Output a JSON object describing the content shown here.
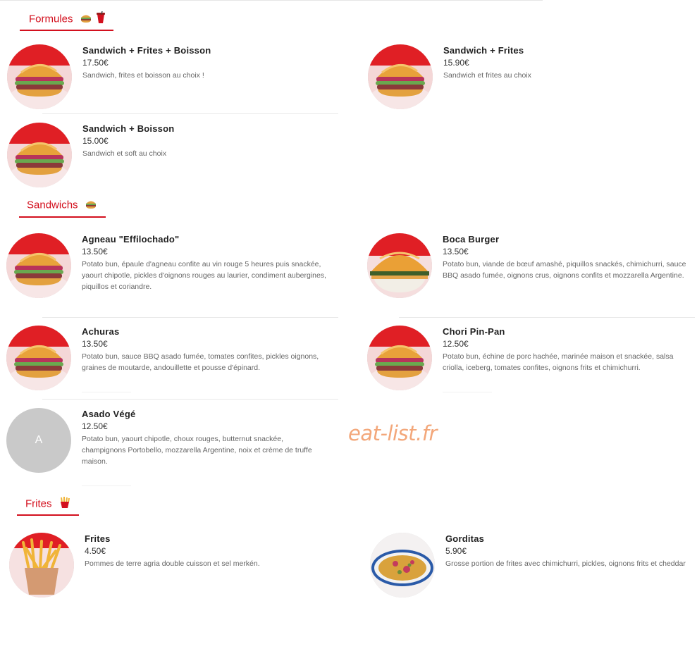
{
  "sections": {
    "formules": {
      "title": "Formules",
      "icons": [
        "burger-emoji",
        "cup-emoji"
      ]
    },
    "sandwichs": {
      "title": "Sandwichs",
      "icons": [
        "burger-emoji"
      ]
    },
    "frites": {
      "title": "Frites",
      "icons": [
        "fries-emoji"
      ]
    }
  },
  "items": {
    "sfb": {
      "name": "Sandwich + Frites + Boisson",
      "price": "17.50€",
      "desc": "Sandwich, frites et boisson au choix !"
    },
    "sf": {
      "name": "Sandwich + Frites",
      "price": "15.90€",
      "desc": "Sandwich et frites au choix"
    },
    "sb": {
      "name": "Sandwich + Boisson",
      "price": "15.00€",
      "desc": "Sandwich et soft au choix"
    },
    "agneau": {
      "name": "Agneau \"Effilochado\"",
      "price": "13.50€",
      "desc": "Potato bun, épaule d'agneau confite au vin rouge 5 heures puis snackée, yaourt chipotle, pickles d'oignons rouges au laurier, condiment aubergines, piquillos et coriandre."
    },
    "boca": {
      "name": "Boca Burger",
      "price": "13.50€",
      "desc": "Potato bun, viande de bœuf amashé, piquillos snackés, chimichurri, sauce BBQ asado fumée, oignons crus, oignons confits et mozzarella Argentine."
    },
    "achuras": {
      "name": "Achuras",
      "price": "13.50€",
      "desc": "Potato bun, sauce BBQ asado fumée, tomates confites, pickles oignons, graines de moutarde, andouillette et pousse d'épinard."
    },
    "chori": {
      "name": "Chori Pin-Pan",
      "price": "12.50€",
      "desc": "Potato bun, échine de porc hachée, marinée maison et snackée, salsa criolla, iceberg, tomates confites, oignons frits et chimichurri."
    },
    "asado": {
      "name": "Asado Végé",
      "price": "12.50€",
      "desc": "Potato bun, yaourt chipotle, choux rouges, butternut snackée, champignons Portobello, mozzarella Argentine, noix et crème de truffe maison.",
      "avatar_letter": "A"
    },
    "frites": {
      "name": "Frites",
      "price": "4.50€",
      "desc": "Pommes de terre agria double cuisson et sel merkén."
    },
    "gorditas": {
      "name": "Gorditas",
      "price": "5.90€",
      "desc": "Grosse portion de frites avec chimichurri, pickles, oignons frits et cheddar"
    }
  },
  "watermark": "eat-list.fr",
  "colors": {
    "accent": "#d3101e",
    "watermark": "#f3a77a",
    "placeholder": "#c9c9c9"
  }
}
